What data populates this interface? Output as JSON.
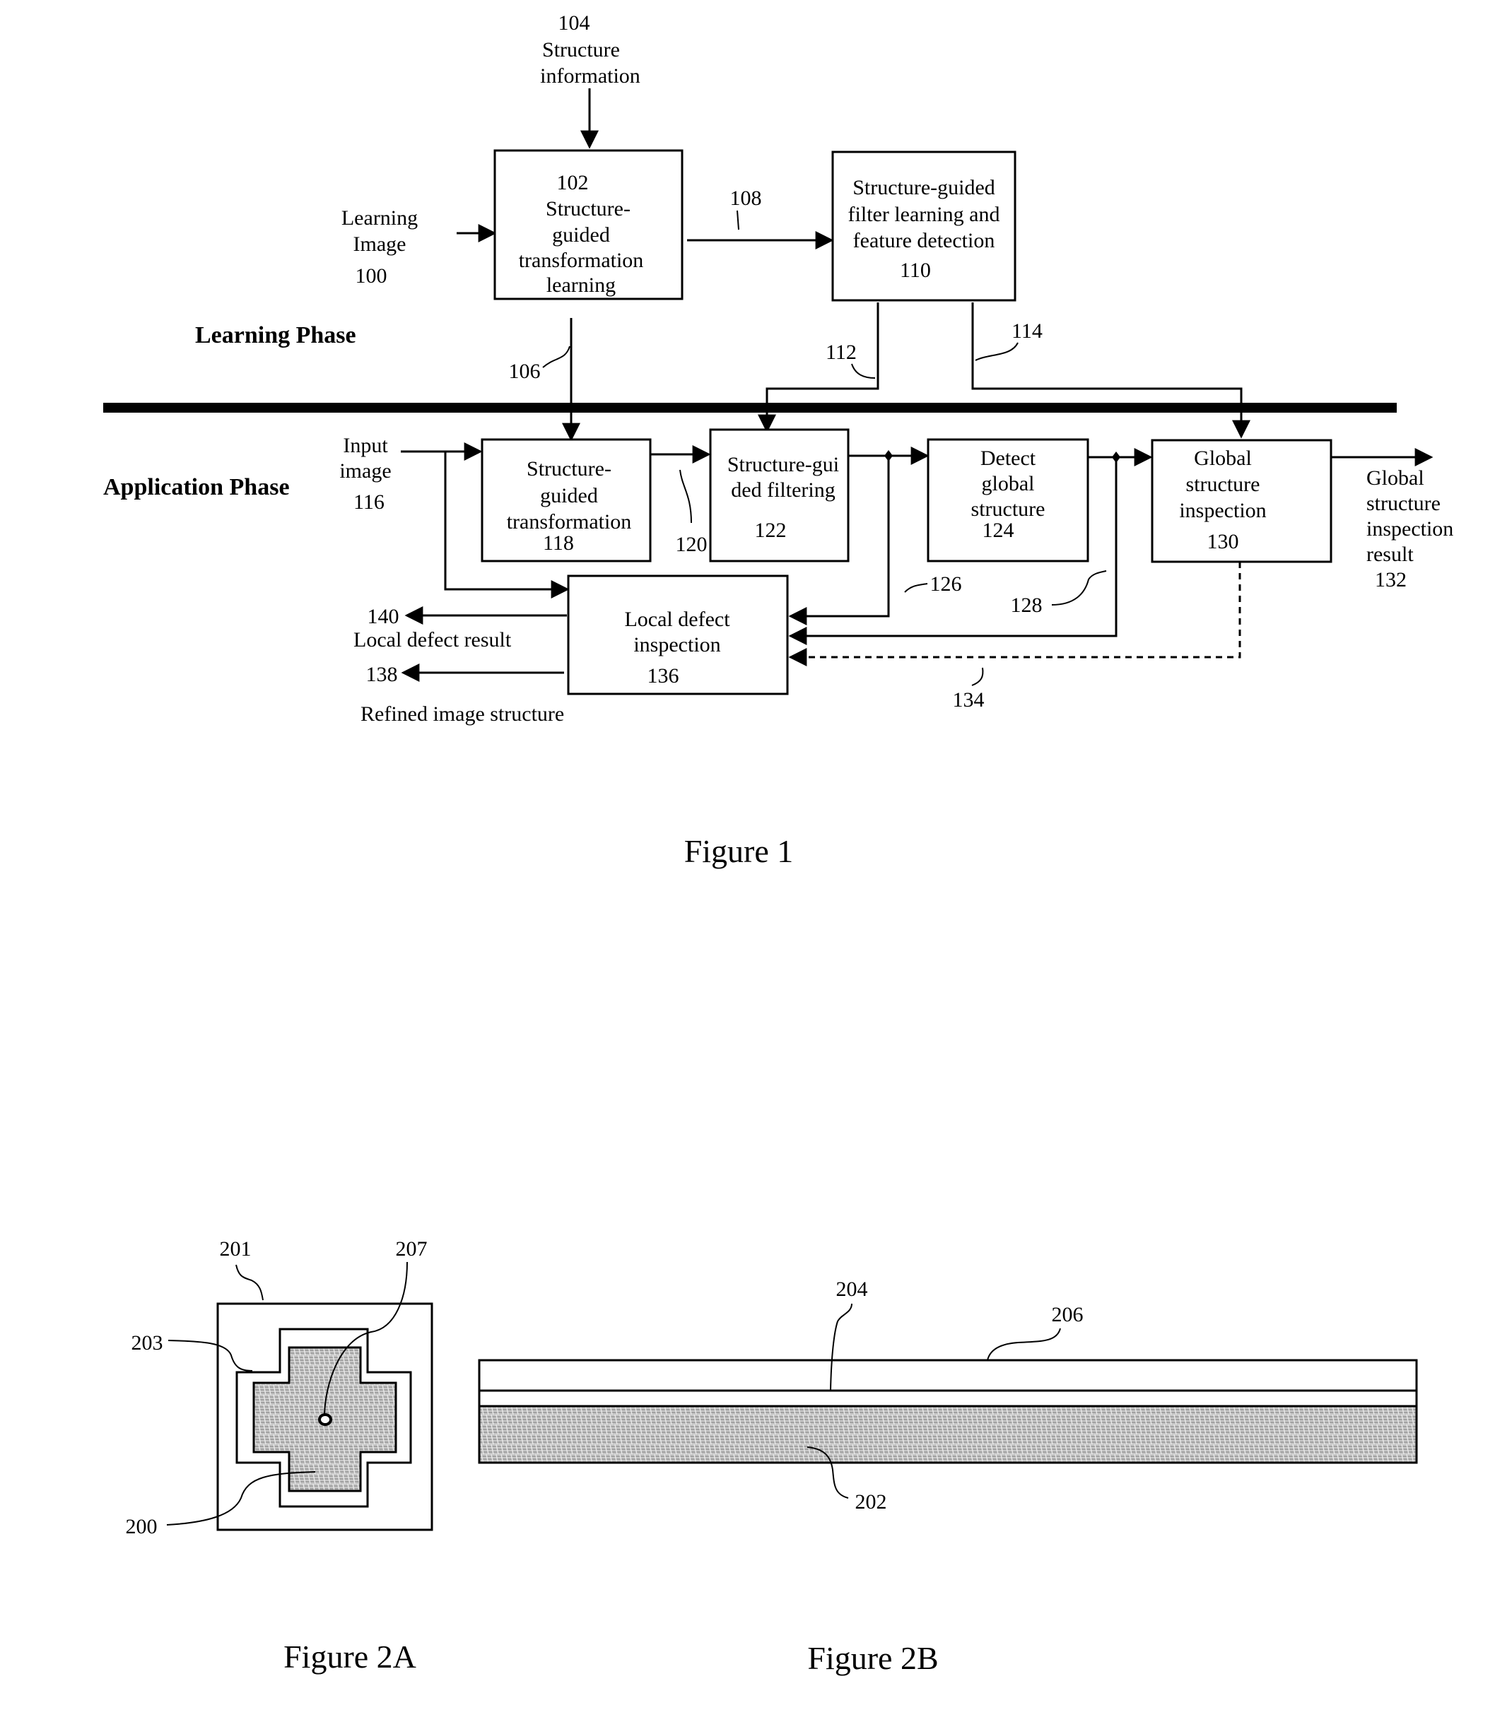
{
  "figure1": {
    "caption": "Figure 1",
    "phases": {
      "learning": "Learning Phase",
      "application": "Application Phase"
    },
    "inputs": {
      "structure_info": [
        "104",
        "Structure",
        "information"
      ],
      "learning_image": [
        "Learning",
        "Image",
        "100"
      ],
      "input_image": [
        "Input",
        "image",
        "116"
      ]
    },
    "blocks": {
      "b102": [
        "102",
        "Structure-",
        "guided",
        "transformation",
        "learning"
      ],
      "b110": [
        "Structure-guided",
        "filter learning and",
        "feature detection",
        "110"
      ],
      "b118": [
        "Structure-",
        "guided",
        "transformation",
        "118"
      ],
      "b122": [
        "Structure-gui",
        "ded filtering",
        "122"
      ],
      "b124": [
        "Detect",
        "global",
        "structure",
        "124"
      ],
      "b130": [
        "Global",
        "structure",
        "inspection",
        "130"
      ],
      "b136": [
        "Local defect",
        "inspection",
        "136"
      ]
    },
    "refs": {
      "r106": "106",
      "r108": "108",
      "r112": "112",
      "r114": "114",
      "r120": "120",
      "r126": "126",
      "r128": "128",
      "r134": "134",
      "r138": "138",
      "r140": "140"
    },
    "outputs": {
      "global_result": [
        "Global",
        "structure",
        "inspection",
        "result",
        "132"
      ],
      "local_defect_result": "Local defect result",
      "refined_structure": "Refined image structure"
    }
  },
  "figure2a": {
    "caption": "Figure 2A",
    "refs": {
      "r200": "200",
      "r201": "201",
      "r203": "203",
      "r207": "207"
    }
  },
  "figure2b": {
    "caption": "Figure 2B",
    "refs": {
      "r202": "202",
      "r204": "204",
      "r206": "206"
    }
  }
}
